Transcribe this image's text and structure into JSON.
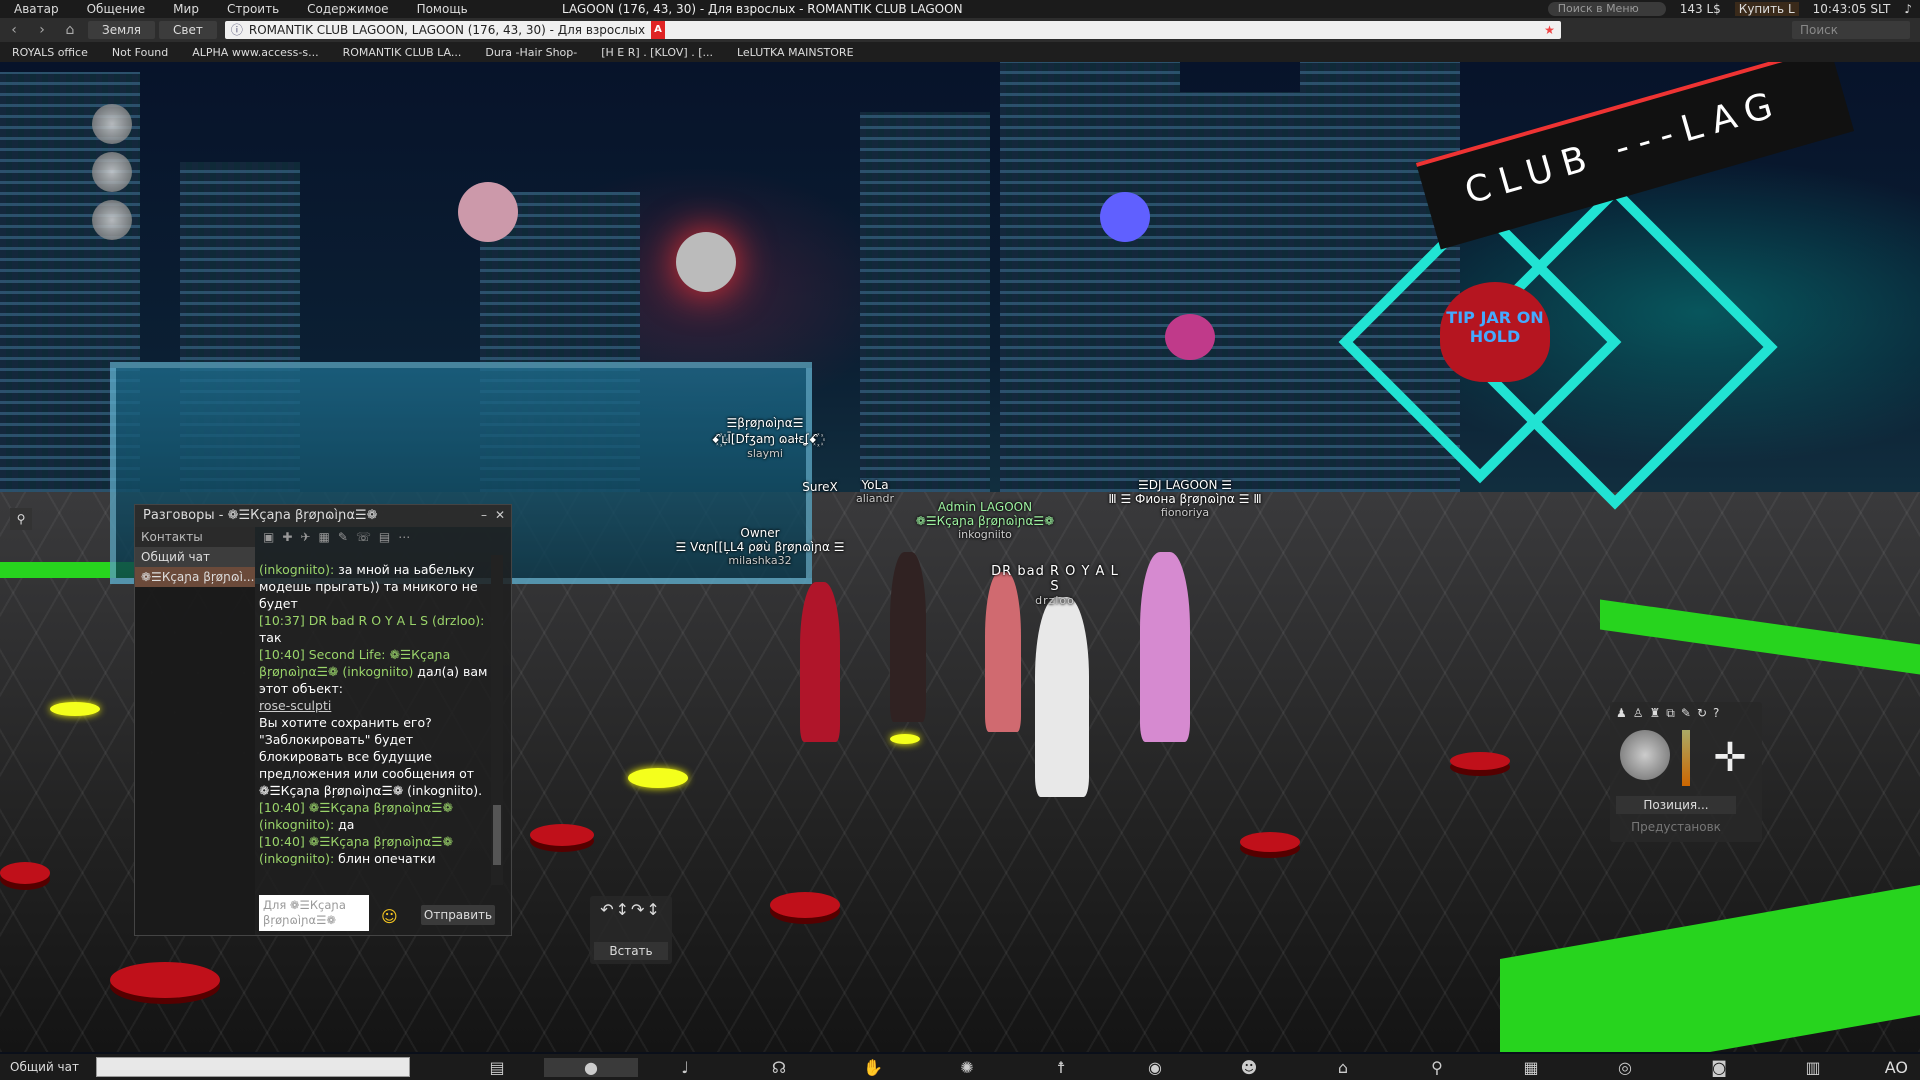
{
  "menubar": {
    "items": [
      "Аватар",
      "Общение",
      "Мир",
      "Строить",
      "Содержимое",
      "Помощь"
    ],
    "title": "LAGOON (176, 43, 30) - Для взрослых - ROMANTIK CLUB LAGOON",
    "search_placeholder": "Поиск в Меню",
    "balance": "143 L$",
    "buy": "Купить L",
    "time": "10:43:05 SLT"
  },
  "navbar": {
    "tab_earth": "Земля",
    "tab_light": "Свет",
    "url": "ROMANTIK CLUB LAGOON, LAGOON (176, 43, 30) - Для взрослых",
    "rating": "A",
    "search_placeholder": "Поиск"
  },
  "favorites": [
    "ROYALS office",
    "Not Found",
    "ALPHA www.access-s...",
    "ROMANTIK CLUB LA...",
    "Dura -Hair Shop-",
    "[H E R] . [KLOV] . [...",
    "LeLUTKA MAINSTORE"
  ],
  "scene": {
    "club_sign": "CLUB ---LAG",
    "tip_jar": "TIP JAR ON HOLD"
  },
  "nametags": [
    {
      "name": "☰βŗøɲɷìɲα☰",
      "line2": "ꗃ꙰ʟĪ[Dfʒaɱ ɷaƚɛʆꗃ꙰",
      "sub": "slaymi"
    },
    {
      "name": "SureX",
      "sub": ""
    },
    {
      "name": "YoLa",
      "sub": "aliandr"
    },
    {
      "name": "Admin LAGOON",
      "line2": "❁☰Кçaɲa βŗøɲɷìɲα☰❁",
      "sub": "inkogniito"
    },
    {
      "name": "☰DJ LAGOON ☰",
      "line2": "Ⅲ ☰ Фиона βŗøɲɷìɲα ☰ Ⅲ",
      "sub": "fionoriya"
    },
    {
      "name": "Owner",
      "line2": "☰ Vαɲ[[ĻL4 ρøù βŗøɲɷìɲα ☰",
      "sub": "milashka32"
    },
    {
      "name": "DR bad R O Y A L S",
      "sub": "drzloo"
    }
  ],
  "chat": {
    "title": "Разговоры - ❁☰Кçaɲa βŗøɲɷìɲα☰❁",
    "contacts": "Контакты",
    "nearby": "Общий чат",
    "selected": "❁☰Кçaɲa βŗøɲɷì...",
    "log": [
      {
        "who": "(inkogniito):",
        "text": " за мной на ьабельку модешь  прыгать)) та мникого не будет"
      },
      {
        "who": "[10:37] DR bad R O Y A L S (drzloo):",
        "text": " так"
      },
      {
        "who": "[10:40] Second Life: ❁☰Кçaɲa βŗøɲɷìɲα☰❁ (inkogniito)",
        "text": " дал(а) вам этот объект:"
      },
      {
        "link": "rose-sculpti"
      },
      {
        "who": "",
        "text": "Вы хотите сохранить его? \"Заблокировать\" будет блокировать все будущие предложения или сообщения от ❁☰Кçaɲa βŗøɲɷìɲα☰❁ (inkogniito)."
      },
      {
        "who": "[10:40] ❁☰Кçaɲa βŗøɲɷìɲα☰❁ (inkogniito):",
        "text": " да"
      },
      {
        "who": "[10:40] ❁☰Кçaɲa βŗøɲɷìɲα☰❁ (inkogniito):",
        "text": " блин опечатки"
      }
    ],
    "input_placeholder": "Для ❁☰Кçaɲa βŗøɲɷìɲα☰❁",
    "send": "Отправить"
  },
  "standup": {
    "label": "Встать"
  },
  "camera": {
    "position": "Позиция...",
    "preset": "Предустановк"
  },
  "bottombar": {
    "label": "Общий чат",
    "ao": "AO"
  },
  "colors": {
    "accent": "#21e3d3",
    "floor_green": "#27d41e",
    "puck_red": "#c0101a"
  }
}
